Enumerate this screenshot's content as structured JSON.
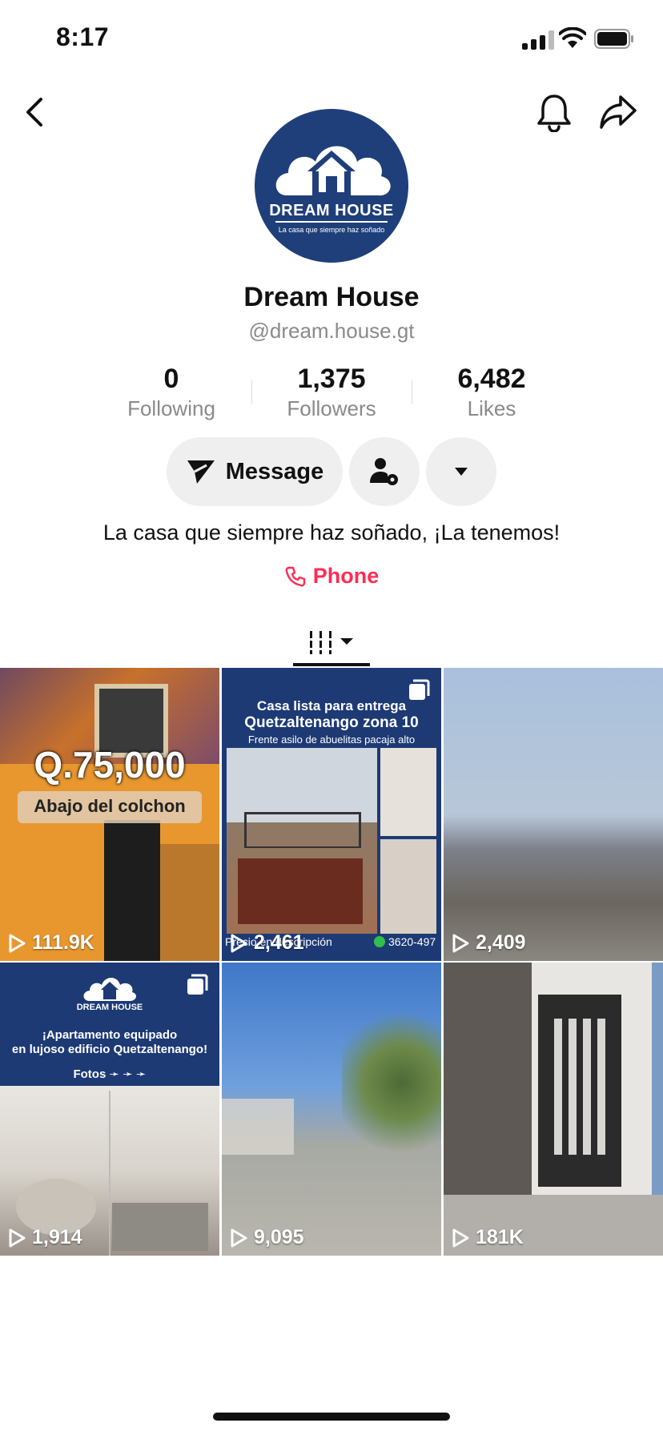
{
  "status_bar": {
    "time": "8:17"
  },
  "profile": {
    "name": "Dream House",
    "handle": "@dream.house.gt",
    "logo_title": "DREAM HOUSE",
    "logo_tagline": "La casa que siempre haz soñado",
    "bio": "La casa que siempre haz soñado, ¡La tenemos!",
    "phone_label": "Phone"
  },
  "stats": [
    {
      "value": "0",
      "label": "Following"
    },
    {
      "value": "1,375",
      "label": "Followers"
    },
    {
      "value": "6,482",
      "label": "Likes"
    }
  ],
  "actions": {
    "message_label": "Message"
  },
  "videos": [
    {
      "views": "111.9K",
      "price": "Q.75,000",
      "caption": "Abajo del colchon"
    },
    {
      "views": "2,461",
      "line1": "Casa lista para entrega",
      "line2": "Quetzaltenango zona 10",
      "line3": "Frente asilo de abuelitas pacaja alto",
      "footer_left": "Precio en descripción",
      "footer_right": "3620-497"
    },
    {
      "views": "2,409"
    },
    {
      "views": "1,914",
      "logo": "DREAM HOUSE",
      "line1": "¡Apartamento equipado",
      "line2": "en lujoso edificio Quetzaltenango!",
      "line3": "Fotos ➛ ➛ ➛"
    },
    {
      "views": "9,095"
    },
    {
      "views": "181K"
    }
  ],
  "colors": {
    "accent": "#fe2c55",
    "brand_blue": "#1f3f7a"
  }
}
